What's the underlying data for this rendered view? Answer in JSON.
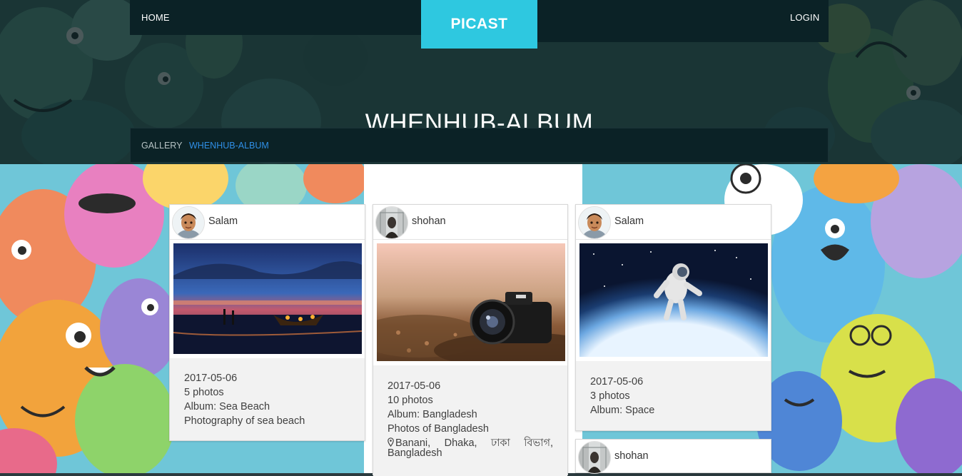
{
  "nav": {
    "home_label": "HOME",
    "brand": "PICAST",
    "login_label": "LOGIN"
  },
  "page": {
    "title": "WHENHUB-ALBUM"
  },
  "breadcrumb": {
    "items": [
      "GALLERY",
      "WHENHUB-ALBUM"
    ]
  },
  "albums": [
    {
      "user": "Salam",
      "image": "sea-beach-night-photo",
      "date": "2017-05-06",
      "photos": "5 photos",
      "album": "Album: Sea Beach",
      "description": "Photography of sea beach"
    },
    {
      "user": "shohan",
      "image": "camera-on-ground-photo",
      "date": "2017-05-06",
      "photos": "10 photos",
      "album": "Album: Bangladesh",
      "description": "Photos of Bangladesh",
      "location": "Banani, Dhaka, ঢাকা বিভাগ, Bangladesh"
    },
    {
      "user": "Salam",
      "image": "astronaut-in-space-photo",
      "date": "2017-05-06",
      "photos": "3 photos",
      "album": "Album: Space"
    },
    {
      "user": "shohan"
    }
  ],
  "colors": {
    "navbar": "#0b2226",
    "brand": "#2ec8e0",
    "breadcrumb_active": "#2f8fe6",
    "card_body": "#f2f2f2"
  }
}
